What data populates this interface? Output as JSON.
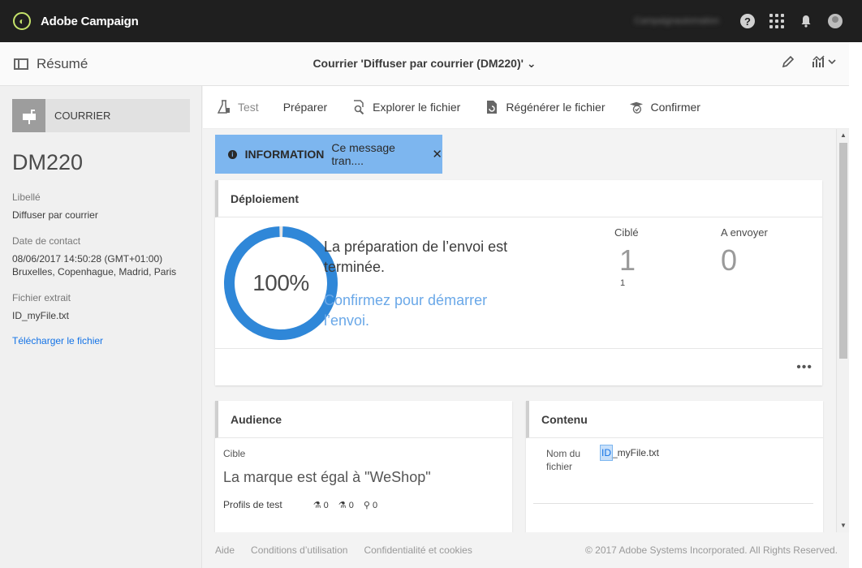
{
  "app": {
    "title": "Adobe Campaign",
    "user_name": "Campaignautomation",
    "logo_glyph": "◐"
  },
  "subheader": {
    "summary_label": "Résumé",
    "doc_title": "Courrier 'Diffuser par courrier (DM220)'"
  },
  "left": {
    "type_label": "COURRIER",
    "code": "DM220",
    "fields": [
      {
        "label": "Libellé",
        "value": "Diffuser par courrier"
      },
      {
        "label": "Date de contact",
        "value": "08/06/2017 14:50:28 (GMT+01:00)",
        "value2": "Bruxelles, Copenhague, Madrid, Paris"
      },
      {
        "label": "Fichier extrait",
        "value": "ID_myFile.txt"
      }
    ],
    "download_link": "Télécharger le fichier"
  },
  "actions": [
    {
      "label": "Test",
      "icon": "flask-icon",
      "glyph": "⚗"
    },
    {
      "label": "Préparer",
      "icon": "",
      "glyph": ""
    },
    {
      "label": "Explorer le fichier",
      "icon": "file-search-icon",
      "glyph": "🔍"
    },
    {
      "label": "Régénérer le fichier",
      "icon": "file-refresh-icon",
      "glyph": "⟳"
    },
    {
      "label": "Confirmer",
      "icon": "confirm-icon",
      "glyph": "✓"
    }
  ],
  "info": {
    "title": "INFORMATION",
    "message": "Ce message tran....",
    "close": "✕"
  },
  "deploy": {
    "title": "Déploiement",
    "progress_percent": 100,
    "progress_label": "100%",
    "message": "La préparation de l’envoi est terminée.",
    "link": "Confirmez pour démarrer l’envoi.",
    "targeted_label": "Ciblé",
    "targeted_value": "1",
    "targeted_sub": "1",
    "to_send_label": "A envoyer",
    "to_send_value": "0",
    "more": "•••"
  },
  "audience": {
    "title": "Audience",
    "target_label": "Cible",
    "target_text": "La marque est égal à \"WeShop\"",
    "profiles_label": "Profils de test",
    "counts": [
      "0",
      "0",
      "0"
    ]
  },
  "content": {
    "title": "Contenu",
    "file_label": "Nom du fichier",
    "file_prefix": "ID",
    "file_rest": "_myFile.txt"
  },
  "footer": {
    "links": [
      "Aide",
      "Conditions d’utilisation",
      "Confidentialité et cookies"
    ],
    "copyright": "© 2017 Adobe Systems Incorporated. All Rights Reserved."
  },
  "colors": {
    "accent": "#1473e6",
    "ring": "#2f87d8",
    "info_bg": "#7db6ef",
    "topbar": "#1f1f1f"
  }
}
